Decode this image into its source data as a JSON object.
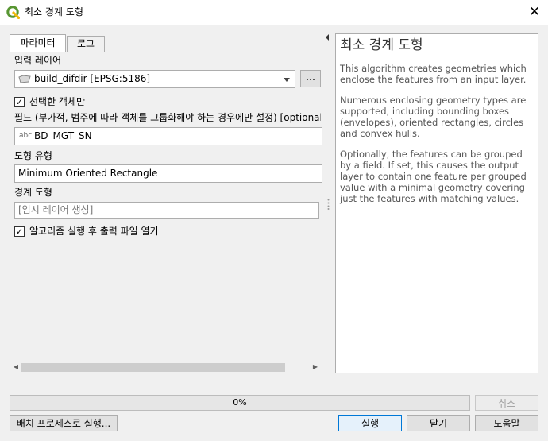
{
  "window": {
    "title": "최소 경계 도형",
    "close_icon": "close-icon"
  },
  "tabs": [
    {
      "label": "파라미터",
      "active": true
    },
    {
      "label": "로그",
      "active": false
    }
  ],
  "params": {
    "input_layer_label": "입력 레이어",
    "input_layer_value": "build_difdir [EPSG:5186]",
    "browse_label": "…",
    "selected_only_label": "선택한 객체만",
    "selected_only_checked": true,
    "field_label": "필드 (부가적, 범주에 따라 객체를 그룹화해야 하는 경우에만 설정) [optional]",
    "field_type_badge": "abc",
    "field_value": "BD_MGT_SN",
    "geometry_type_label": "도형 유형",
    "geometry_type_value": "Minimum Oriented Rectangle",
    "bounding_label": "경계 도형",
    "bounding_placeholder": "[임시 레이어 생성]",
    "open_output_label": "알고리즘 실행 후 출력 파일 열기",
    "open_output_checked": true
  },
  "help": {
    "title": "최소 경계 도형",
    "paragraphs": [
      "This algorithm creates geometries which enclose the features from an input layer.",
      "Numerous enclosing geometry types are supported, including bounding boxes (envelopes), oriented rectangles, circles and convex hulls.",
      "Optionally, the features can be grouped by a field. If set, this causes the output layer to contain one feature per grouped value with a minimal geometry covering just the features with matching values."
    ]
  },
  "progress": {
    "value": 0,
    "text": "0%"
  },
  "buttons": {
    "cancel": "취소",
    "batch": "배치 프로세스로 실행...",
    "run": "실행",
    "close": "닫기",
    "help": "도움말"
  },
  "colors": {
    "accent": "#0078d7",
    "qgis_green": "#589632",
    "qgis_yellow": "#ee7913"
  }
}
